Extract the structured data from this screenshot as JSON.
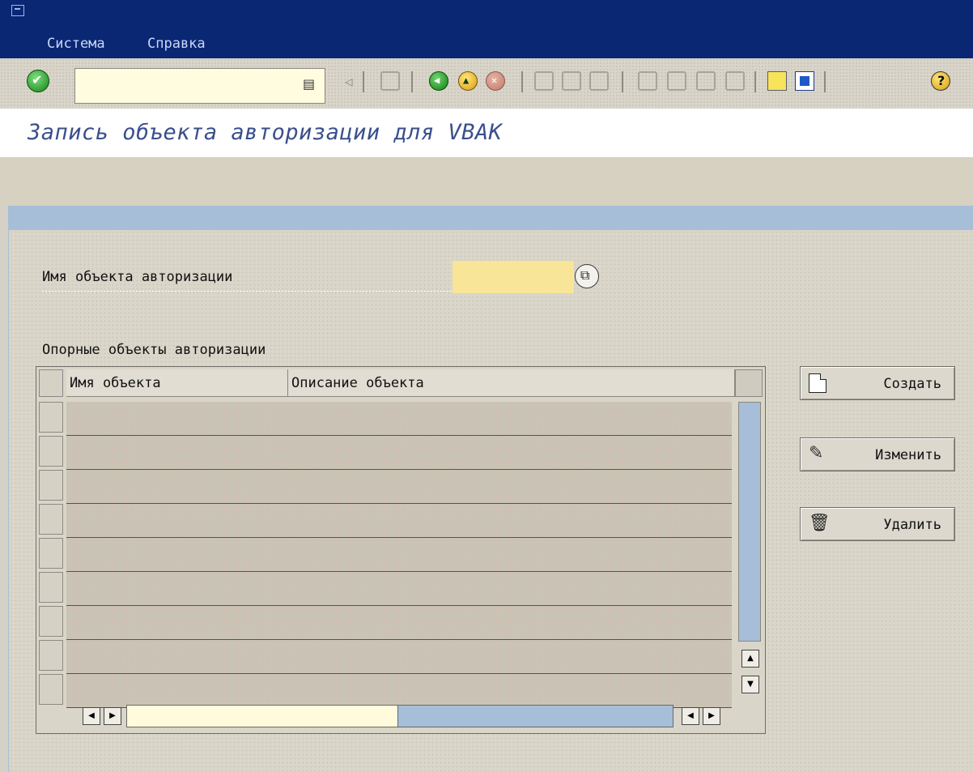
{
  "menu": {
    "system": "Система",
    "help": "Справка"
  },
  "command_field": {
    "value": ""
  },
  "screen": {
    "title": "Запись объекта авторизации для VBAK"
  },
  "form": {
    "auth_object_label": "Имя объекта авторизации",
    "auth_object_value": "",
    "reference_label": "Опорные объекты авторизации"
  },
  "table": {
    "columns": [
      "Имя объекта",
      "Описание объекта"
    ],
    "rows": [
      "",
      "",
      "",
      "",
      "",
      "",
      "",
      "",
      ""
    ]
  },
  "buttons": {
    "create": "Создать",
    "change": "Изменить",
    "delete": "Удалить"
  },
  "colors": {
    "title_bar": "#0a2774",
    "title_text": "#3a4f8c",
    "input_required": "#f9e597",
    "scroll_blue": "#a6bed7"
  },
  "icons": [
    "enter-icon",
    "save-icon",
    "back-icon",
    "exit-icon",
    "cancel-icon",
    "print-icon",
    "find-icon",
    "help-icon",
    "create-icon",
    "pencil-icon",
    "trash-icon"
  ]
}
